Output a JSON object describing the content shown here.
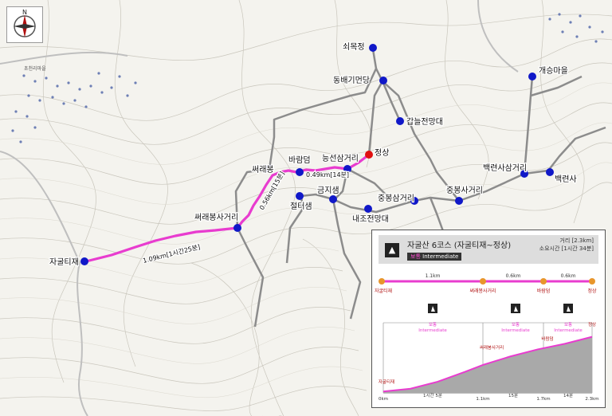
{
  "compass_letter": "N",
  "town_label": "초천리마을",
  "map_labels": {
    "soemokjeong": "쇠목정",
    "dongbaegimyeondang": "동배기먼당",
    "gaeseungmaeul": "개승마을",
    "gamnuljeonmangdae": "갑늘전망대",
    "baekryeonsasamgeori": "백련사삼거리",
    "baekryeonsa": "백련사",
    "jeongsang": "정상",
    "neungseonsamgeori": "능선삼거리",
    "baramdeom": "바람덤",
    "ssaraebong": "써래봉",
    "geumjisaem": "금지샘",
    "jeolteosaem": "절터샘",
    "jungbongsamgeori": "중봉삼거리",
    "naejojeonmangdae": "내조전망대",
    "jungbongsageori": "중봉사거리",
    "ssaraebongsageori": "써래봉사거리",
    "jagultijae": "자굴티재"
  },
  "segment_labels": {
    "seg1": "1.09km[1시간25분]",
    "seg2": "0.56km[15분]",
    "seg3": "0.49km[14분]"
  },
  "colors": {
    "trail": "#e83ccf",
    "point": "#1018c8",
    "summit": "#e01010",
    "path": "#8c8c8c",
    "road": "#bfbfbf"
  },
  "panel": {
    "title": "자굴산 6코스 (자굴티재~정상)",
    "distance": "거리 [2.3km]",
    "duration": "소요시간 [1시간 34분]",
    "level_ko": "보통",
    "level_en": "Intermediate",
    "route": {
      "points": [
        {
          "name": "자굴티재",
          "km": 0
        },
        {
          "name": "써래봉사거리",
          "km": 1.1
        },
        {
          "name": "바람덤",
          "km": 1.7
        },
        {
          "name": "정상",
          "km": 2.3
        }
      ],
      "segments": [
        "1.1km",
        "0.6km",
        "0.6km"
      ]
    },
    "profile": {
      "level_ko": "보통",
      "level_en": "Intermediate",
      "start_label": "자굴티재",
      "ssaraebong_label": "써래봉사거리",
      "baramdeom_label": "바람덤",
      "summit_label": "정상",
      "x_ticks": [
        "0km",
        "1.1km",
        "1.7km",
        "2.3km"
      ],
      "segment_times": [
        "1시간 5분",
        "15분",
        "14분"
      ],
      "elevation": [
        {
          "km": 0,
          "rel": 0.02
        },
        {
          "km": 0.3,
          "rel": 0.06
        },
        {
          "km": 0.6,
          "rel": 0.16
        },
        {
          "km": 0.9,
          "rel": 0.3
        },
        {
          "km": 1.1,
          "rel": 0.4
        },
        {
          "km": 1.4,
          "rel": 0.52
        },
        {
          "km": 1.7,
          "rel": 0.62
        },
        {
          "km": 2.0,
          "rel": 0.7
        },
        {
          "km": 2.3,
          "rel": 0.8
        }
      ]
    }
  }
}
